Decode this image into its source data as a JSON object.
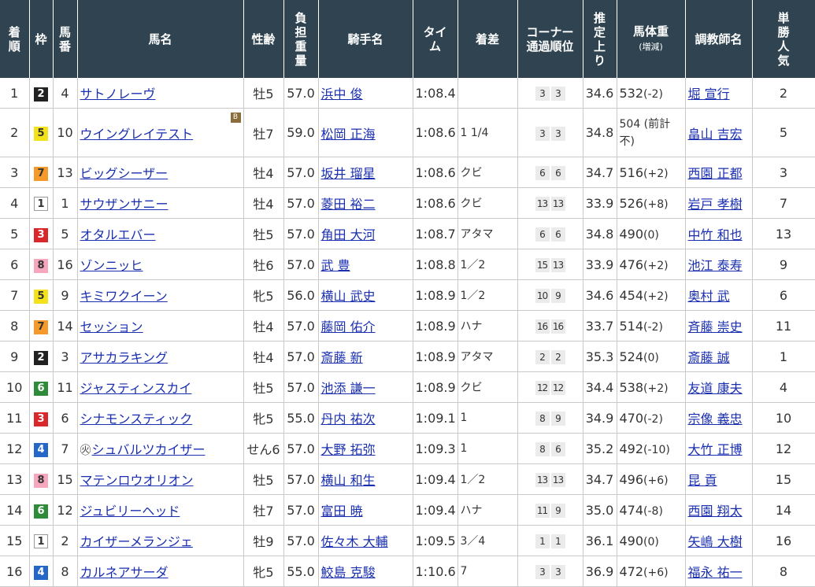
{
  "headers": {
    "rank": "着順",
    "waku": "枠",
    "umaban": "馬番",
    "horse": "馬名",
    "sexage": "性齢",
    "weight": "負担重量",
    "jockey": "騎手名",
    "time": "タイム",
    "margin": "着差",
    "corner": "コーナー通過順位",
    "last3f": "推定上り",
    "bodyweight": "馬体重",
    "bodyweight_sub": "(増減)",
    "trainer": "調教師名",
    "pop": "単勝人気"
  },
  "rows": [
    {
      "rank": "1",
      "waku": "2",
      "umaban": "4",
      "horse": "サトノレーヴ",
      "mark": "",
      "blinker": "",
      "sexage": "牡5",
      "weight": "57.0",
      "jockey": "浜中 俊",
      "time": "1:08.4",
      "margin": "",
      "c1": "3",
      "c2": "3",
      "last3f": "34.6",
      "bw": "532",
      "bwc": "(-2)",
      "trainer": "堀 宣行",
      "pop": "2"
    },
    {
      "rank": "2",
      "waku": "5",
      "umaban": "10",
      "horse": "ウイングレイテスト",
      "mark": "",
      "blinker": "B",
      "sexage": "牡7",
      "weight": "59.0",
      "jockey": "松岡 正海",
      "time": "1:08.6",
      "margin": "1 1/4",
      "c1": "3",
      "c2": "3",
      "last3f": "34.8",
      "bw": "504 (前計不)",
      "bwc": "",
      "trainer": "畠山 吉宏",
      "pop": "5"
    },
    {
      "rank": "3",
      "waku": "7",
      "umaban": "13",
      "horse": "ビッグシーザー",
      "mark": "",
      "blinker": "",
      "sexage": "牡4",
      "weight": "57.0",
      "jockey": "坂井 瑠星",
      "time": "1:08.6",
      "margin": "クビ",
      "c1": "6",
      "c2": "6",
      "last3f": "34.7",
      "bw": "516",
      "bwc": "(+2)",
      "trainer": "西園 正都",
      "pop": "3"
    },
    {
      "rank": "4",
      "waku": "1",
      "umaban": "1",
      "horse": "サウザンサニー",
      "mark": "",
      "blinker": "",
      "sexage": "牡4",
      "weight": "57.0",
      "jockey": "菱田 裕二",
      "time": "1:08.6",
      "margin": "クビ",
      "c1": "13",
      "c2": "13",
      "last3f": "33.9",
      "bw": "526",
      "bwc": "(+8)",
      "trainer": "岩戸 孝樹",
      "pop": "7"
    },
    {
      "rank": "5",
      "waku": "3",
      "umaban": "5",
      "horse": "オタルエバー",
      "mark": "",
      "blinker": "",
      "sexage": "牡5",
      "weight": "57.0",
      "jockey": "角田 大河",
      "time": "1:08.7",
      "margin": "アタマ",
      "c1": "6",
      "c2": "6",
      "last3f": "34.8",
      "bw": "490",
      "bwc": "(0)",
      "trainer": "中竹 和也",
      "pop": "13"
    },
    {
      "rank": "6",
      "waku": "8",
      "umaban": "16",
      "horse": "ゾンニッヒ",
      "mark": "",
      "blinker": "",
      "sexage": "牡6",
      "weight": "57.0",
      "jockey": "武 豊",
      "time": "1:08.8",
      "margin": "1／2",
      "c1": "15",
      "c2": "13",
      "last3f": "33.9",
      "bw": "476",
      "bwc": "(+2)",
      "trainer": "池江 泰寿",
      "pop": "9"
    },
    {
      "rank": "7",
      "waku": "5",
      "umaban": "9",
      "horse": "キミワクイーン",
      "mark": "",
      "blinker": "",
      "sexage": "牝5",
      "weight": "56.0",
      "jockey": "横山 武史",
      "time": "1:08.9",
      "margin": "1／2",
      "c1": "10",
      "c2": "9",
      "last3f": "34.6",
      "bw": "454",
      "bwc": "(+2)",
      "trainer": "奥村 武",
      "pop": "6"
    },
    {
      "rank": "8",
      "waku": "7",
      "umaban": "14",
      "horse": "セッション",
      "mark": "",
      "blinker": "",
      "sexage": "牡4",
      "weight": "57.0",
      "jockey": "藤岡 佑介",
      "time": "1:08.9",
      "margin": "ハナ",
      "c1": "16",
      "c2": "16",
      "last3f": "33.7",
      "bw": "514",
      "bwc": "(-2)",
      "trainer": "斉藤 崇史",
      "pop": "11"
    },
    {
      "rank": "9",
      "waku": "2",
      "umaban": "3",
      "horse": "アサカラキング",
      "mark": "",
      "blinker": "",
      "sexage": "牡4",
      "weight": "57.0",
      "jockey": "斎藤 新",
      "time": "1:08.9",
      "margin": "アタマ",
      "c1": "2",
      "c2": "2",
      "last3f": "35.3",
      "bw": "524",
      "bwc": "(0)",
      "trainer": "斎藤 誠",
      "pop": "1"
    },
    {
      "rank": "10",
      "waku": "6",
      "umaban": "11",
      "horse": "ジャスティンスカイ",
      "mark": "",
      "blinker": "",
      "sexage": "牡5",
      "weight": "57.0",
      "jockey": "池添 謙一",
      "time": "1:08.9",
      "margin": "クビ",
      "c1": "12",
      "c2": "12",
      "last3f": "34.4",
      "bw": "538",
      "bwc": "(+2)",
      "trainer": "友道 康夫",
      "pop": "4"
    },
    {
      "rank": "11",
      "waku": "3",
      "umaban": "6",
      "horse": "シナモンスティック",
      "mark": "",
      "blinker": "",
      "sexage": "牝5",
      "weight": "55.0",
      "jockey": "丹内 祐次",
      "time": "1:09.1",
      "margin": "1",
      "c1": "8",
      "c2": "9",
      "last3f": "34.9",
      "bw": "470",
      "bwc": "(-2)",
      "trainer": "宗像 義忠",
      "pop": "10"
    },
    {
      "rank": "12",
      "waku": "4",
      "umaban": "7",
      "horse": "シュバルツカイザー",
      "mark": "外",
      "blinker": "",
      "sexage": "せん6",
      "weight": "57.0",
      "jockey": "大野 拓弥",
      "time": "1:09.3",
      "margin": "1",
      "c1": "8",
      "c2": "6",
      "last3f": "35.2",
      "bw": "492",
      "bwc": "(-10)",
      "trainer": "大竹 正博",
      "pop": "12"
    },
    {
      "rank": "13",
      "waku": "8",
      "umaban": "15",
      "horse": "マテンロウオリオン",
      "mark": "",
      "blinker": "",
      "sexage": "牡5",
      "weight": "57.0",
      "jockey": "横山 和生",
      "time": "1:09.4",
      "margin": "1／2",
      "c1": "13",
      "c2": "13",
      "last3f": "34.7",
      "bw": "496",
      "bwc": "(+6)",
      "trainer": "昆 貢",
      "pop": "15"
    },
    {
      "rank": "14",
      "waku": "6",
      "umaban": "12",
      "horse": "ジュビリーヘッド",
      "mark": "",
      "blinker": "",
      "sexage": "牡7",
      "weight": "57.0",
      "jockey": "富田 暁",
      "time": "1:09.4",
      "margin": "ハナ",
      "c1": "11",
      "c2": "9",
      "last3f": "35.0",
      "bw": "474",
      "bwc": "(-8)",
      "trainer": "西園 翔太",
      "pop": "14"
    },
    {
      "rank": "15",
      "waku": "1",
      "umaban": "2",
      "horse": "カイザーメランジェ",
      "mark": "",
      "blinker": "",
      "sexage": "牡9",
      "weight": "57.0",
      "jockey": "佐々木 大輔",
      "time": "1:09.5",
      "margin": "3／4",
      "c1": "1",
      "c2": "1",
      "last3f": "36.1",
      "bw": "490",
      "bwc": "(0)",
      "trainer": "矢嶋 大樹",
      "pop": "16"
    },
    {
      "rank": "16",
      "waku": "4",
      "umaban": "8",
      "horse": "カルネアサーダ",
      "mark": "",
      "blinker": "",
      "sexage": "牝5",
      "weight": "55.0",
      "jockey": "鮫島 克駿",
      "time": "1:10.6",
      "margin": "7",
      "c1": "3",
      "c2": "3",
      "last3f": "36.9",
      "bw": "472",
      "bwc": "(+6)",
      "trainer": "福永 祐一",
      "pop": "8"
    }
  ]
}
